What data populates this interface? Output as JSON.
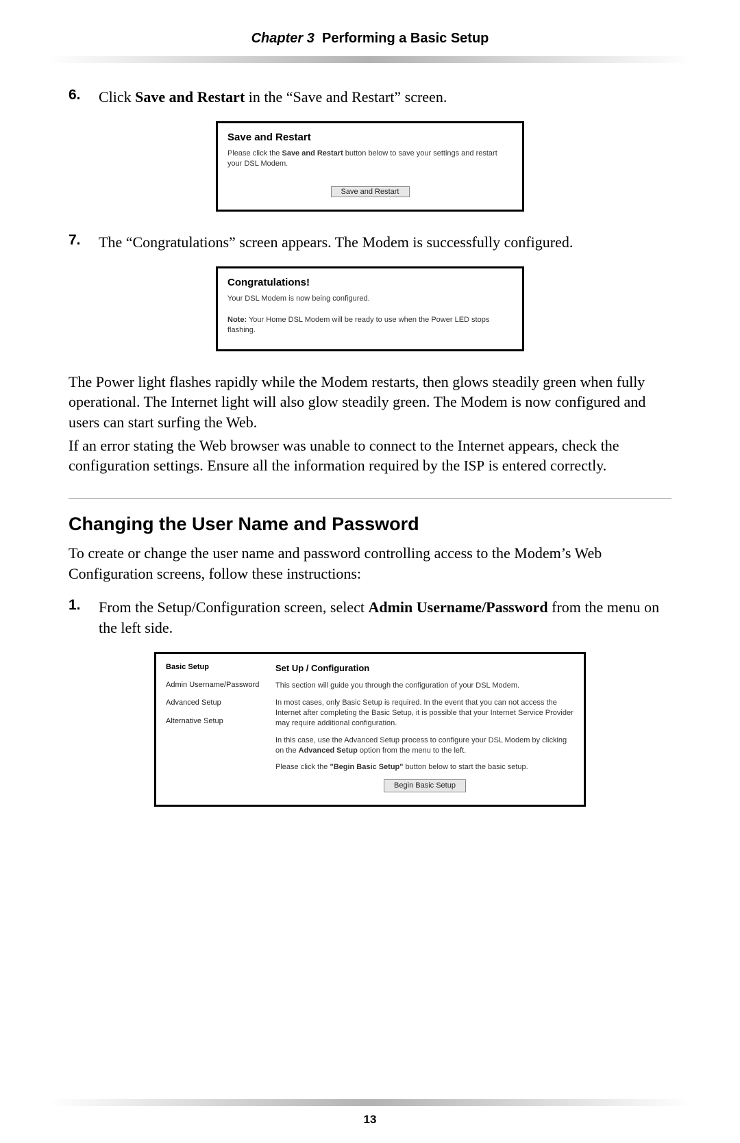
{
  "header": {
    "chapter_label": "Chapter 3",
    "chapter_title": "Performing a Basic Setup"
  },
  "step6": {
    "num": "6.",
    "text_pre": "Click ",
    "text_bold": "Save and Restart",
    "text_post": " in the “Save and Restart” screen."
  },
  "shot1": {
    "title": "Save and Restart",
    "text_pre": "Please click the ",
    "text_bold": "Save and Restart",
    "text_post": " button below to save your settings and restart your DSL Modem.",
    "button": "Save and Restart"
  },
  "step7": {
    "num": "7.",
    "text": "The “Congratulations” screen appears. The Modem is successfully configured."
  },
  "shot2": {
    "title": "Congratulations!",
    "line1": "Your DSL Modem is now being configured.",
    "note_label": "Note:",
    "note_text": " Your Home DSL Modem will be ready to use when the Power LED stops flashing."
  },
  "para1": "The Power light flashes rapidly while the Modem restarts, then glows steadily green when fully operational. The Internet light will also glow steadily green. The Modem is now configured and users can start surfing the Web.",
  "para2_pre": "If an error stating the Web browser was unable to connect to the Internet appears, check the configuration settings. Ensure all the information required by the ",
  "para2_isp": "ISP",
  "para2_post": " is entered correctly.",
  "section_heading": "Changing the User Name and Password",
  "section_intro": "To create or change the user name and password controlling access to the Modem’s Web Configuration screens, follow these instructions:",
  "step1": {
    "num": "1.",
    "text_pre": "From the Setup/Configuration screen, select ",
    "text_bold": "Admin Username/Password",
    "text_post": " from the menu on the left side."
  },
  "shot3": {
    "menu": {
      "head": "Basic Setup",
      "items": [
        "Admin Username/Password",
        "Advanced Setup",
        "Alternative Setup"
      ]
    },
    "main": {
      "head": "Set Up / Configuration",
      "p1": "This section will guide you through the configuration of your DSL Modem.",
      "p2": "In most cases, only Basic Setup is required. In the event that you can not access the Internet after completing the Basic Setup, it is possible that your Internet Service Provider may require additional configuration.",
      "p3_pre": "In this case, use the Advanced Setup process to configure your DSL Modem by clicking on the ",
      "p3_bold": "Advanced Setup",
      "p3_post": " option from the menu to the left.",
      "p4_pre": "Please click the ",
      "p4_bold": "\"Begin Basic Setup\"",
      "p4_post": " button below to start the basic setup.",
      "button": "Begin Basic Setup"
    }
  },
  "page_number": "13"
}
